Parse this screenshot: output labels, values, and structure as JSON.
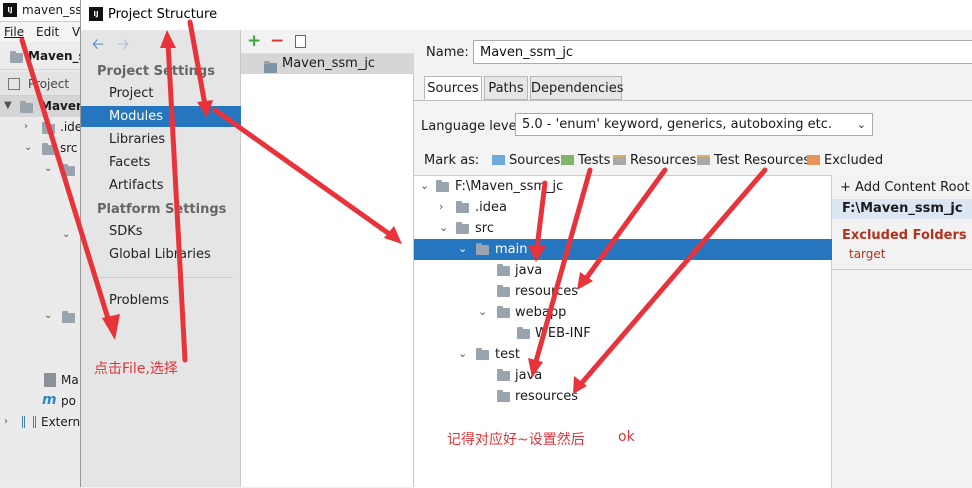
{
  "ide": {
    "window_title": "maven_ss",
    "logo": "IJ",
    "menu": [
      "File",
      "Edit",
      "V"
    ],
    "project_name": "Maven_s",
    "tool_window": "Project",
    "tree": [
      {
        "label": "Maven"
      },
      {
        "label": ".ide"
      },
      {
        "label": "src"
      },
      {
        "label": "Ma"
      },
      {
        "label": "po"
      },
      {
        "label": "Extern"
      }
    ]
  },
  "dialog": {
    "title": "Project Structure",
    "nav": {
      "back_icon": "arrow-left-icon",
      "forward_icon": "arrow-right-icon",
      "project_settings_header": "Project Settings",
      "project_settings": [
        "Project",
        "Modules",
        "Libraries",
        "Facets",
        "Artifacts"
      ],
      "platform_settings_header": "Platform Settings",
      "platform_settings": [
        "SDKs",
        "Global Libraries"
      ],
      "problems": "Problems",
      "selected": "Modules"
    },
    "modules": {
      "toolbar": {
        "add": "+",
        "remove": "−",
        "copy_icon": "copy-icon"
      },
      "items": [
        "Maven_ssm_jc"
      ]
    },
    "detail": {
      "name_label": "Name:",
      "name_value": "Maven_ssm_jc",
      "tabs": [
        "Sources",
        "Paths",
        "Dependencies"
      ],
      "active_tab": "Sources",
      "language_level_label": "Language level:",
      "language_level_value": "5.0 - 'enum' keyword, generics, autoboxing etc.",
      "mark_as_label": "Mark as:",
      "mark_as": [
        {
          "label": "Sources",
          "color": "#6fa8dc"
        },
        {
          "label": "Tests",
          "color": "#7fb66a"
        },
        {
          "label": "Resources",
          "color": "#a8a8a8"
        },
        {
          "label": "Test Resources",
          "color": "#a8a8a8"
        },
        {
          "label": "Excluded",
          "color": "#e8935b"
        }
      ],
      "tree": [
        {
          "label": "F:\\Maven_ssm_jc"
        },
        {
          "label": ".idea"
        },
        {
          "label": "src"
        },
        {
          "label": "main"
        },
        {
          "label": "java"
        },
        {
          "label": "resources"
        },
        {
          "label": "webapp"
        },
        {
          "label": "WEB-INF"
        },
        {
          "label": "test"
        },
        {
          "label": "java"
        },
        {
          "label": "resources"
        }
      ],
      "selected_node": "main",
      "content_roots": {
        "add_label": "Add Content Root",
        "root_path": "F:\\Maven_ssm_jc",
        "excluded_header": "Excluded Folders",
        "excluded": [
          "target"
        ]
      }
    }
  },
  "annotations": {
    "note1": "点击File,选择",
    "note2": "记得对应好~设置然后",
    "note3": "ok",
    "arrow_color": "#e8333a"
  }
}
